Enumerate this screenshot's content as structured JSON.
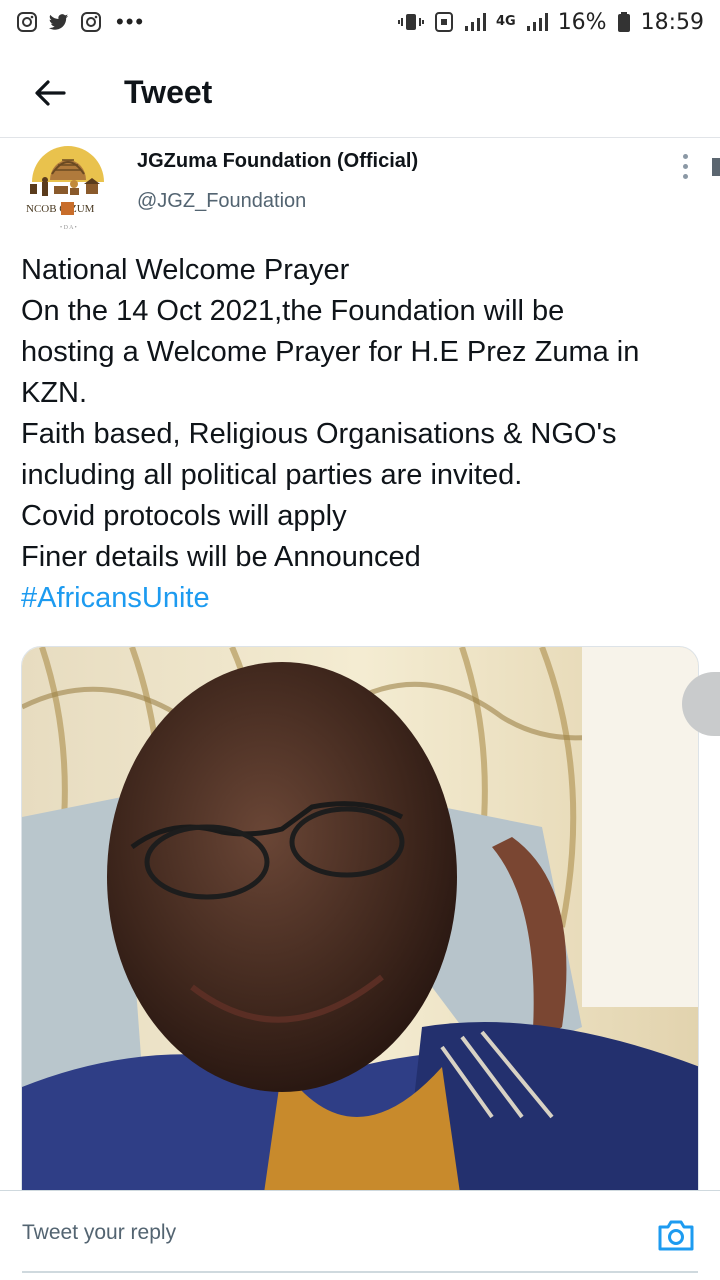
{
  "status_bar": {
    "left_icons": [
      "instagram-icon",
      "twitter-icon",
      "instagram-icon"
    ],
    "overflow": "•••",
    "network": "4G",
    "battery": "16%",
    "time": "18:59"
  },
  "header": {
    "title": "Tweet",
    "back_icon": "arrow-left-icon"
  },
  "tweet": {
    "author": {
      "name": "JGZuma Foundation (Official)",
      "handle": "@JGZ_Foundation",
      "avatar_icon": "foundation-logo",
      "avatar_text": "NCOB G ZUM"
    },
    "lines": [
      "National Welcome Prayer",
      "On the 14 Oct 2021,the Foundation will be",
      "hosting a Welcome Prayer for H.E Prez Zuma in",
      "KZN.",
      "Faith based, Religious Organisations & NGO's",
      "including all political parties are invited.",
      "Covid protocols will apply",
      "Finer details will be Announced"
    ],
    "hashtag": "#AfricansUnite",
    "media_icon": "photo"
  },
  "reply": {
    "placeholder": "Tweet your reply",
    "camera_icon": "camera-icon"
  },
  "colors": {
    "accent": "#1d9bf0",
    "text": "#0f1419",
    "secondary": "#536471"
  }
}
